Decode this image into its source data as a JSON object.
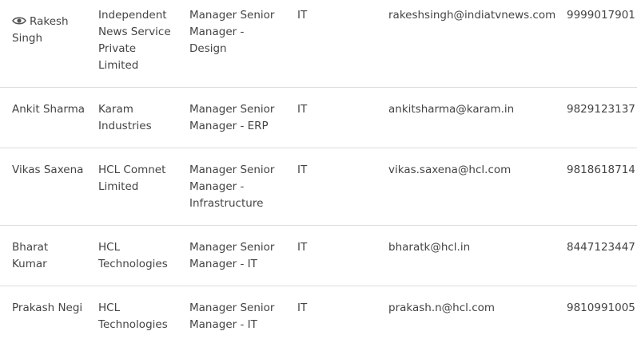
{
  "rows": [
    {
      "name": "Rakesh Singh",
      "company": "Independent News Service Private Limited",
      "designation": "Manager Senior Manager - Design",
      "department": "IT",
      "email": "rakeshsingh@indiatvnews.com",
      "phone": "9999017901",
      "has_view_icon": true
    },
    {
      "name": "Ankit Sharma",
      "company": "Karam Industries",
      "designation": "Manager Senior Manager - ERP",
      "department": "IT",
      "email": "ankitsharma@karam.in",
      "phone": "9829123137"
    },
    {
      "name": "Vikas Saxena",
      "company": "HCL Comnet Limited",
      "designation": "Manager Senior Manager - Infrastructure",
      "department": "IT",
      "email": "vikas.saxena@hcl.com",
      "phone": "9818618714"
    },
    {
      "name": "Bharat Kumar",
      "company": "HCL Technologies",
      "designation": "Manager Senior Manager - IT",
      "department": "IT",
      "email": "bharatk@hcl.in",
      "phone": "8447123447"
    },
    {
      "name": "Prakash Negi",
      "company": "HCL Technologies",
      "designation": "Manager Senior Manager - IT",
      "department": "IT",
      "email": "prakash.n@hcl.com",
      "phone": "9810991005"
    }
  ],
  "icons": {
    "view": "eye-icon"
  }
}
